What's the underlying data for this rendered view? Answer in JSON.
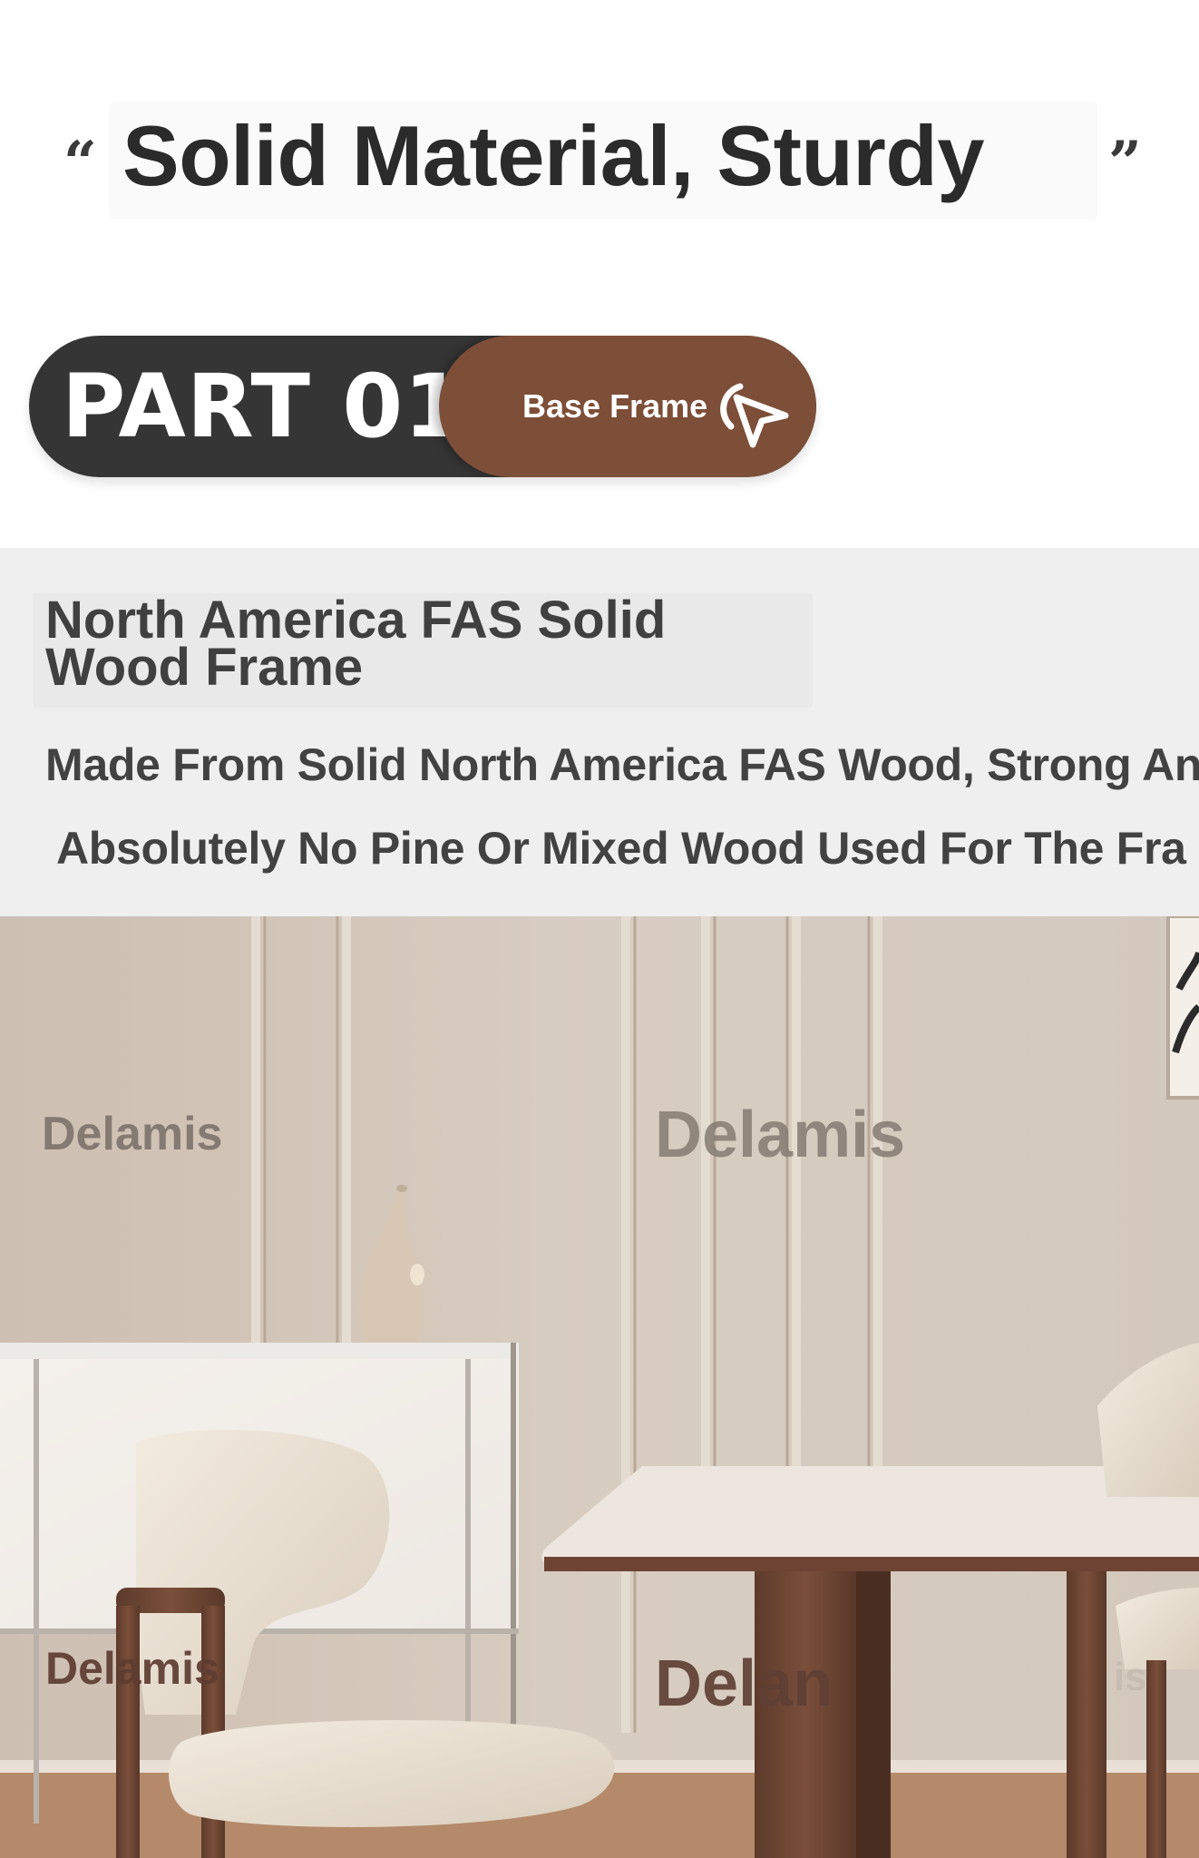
{
  "header": {
    "headline": "Solid Material, Sturdy",
    "open_quote": "“",
    "close_quote": "”"
  },
  "part": {
    "label": "PART 01",
    "tab_label": "Base Frame",
    "tab_icon": "cursor-click-icon",
    "colors": {
      "pill": "#353535",
      "tab": "#7d4e38"
    }
  },
  "description": {
    "title": "North America FAS Solid Wood Frame",
    "line_1": "Made From Solid North America FAS Wood, Strong An",
    "line_2": "Absolutely No Pine Or Mixed Wood Used For The Fra"
  },
  "scene": {
    "watermarks": [
      "Delamis",
      "Delamis",
      "Delamis",
      "Delan",
      "is"
    ]
  }
}
